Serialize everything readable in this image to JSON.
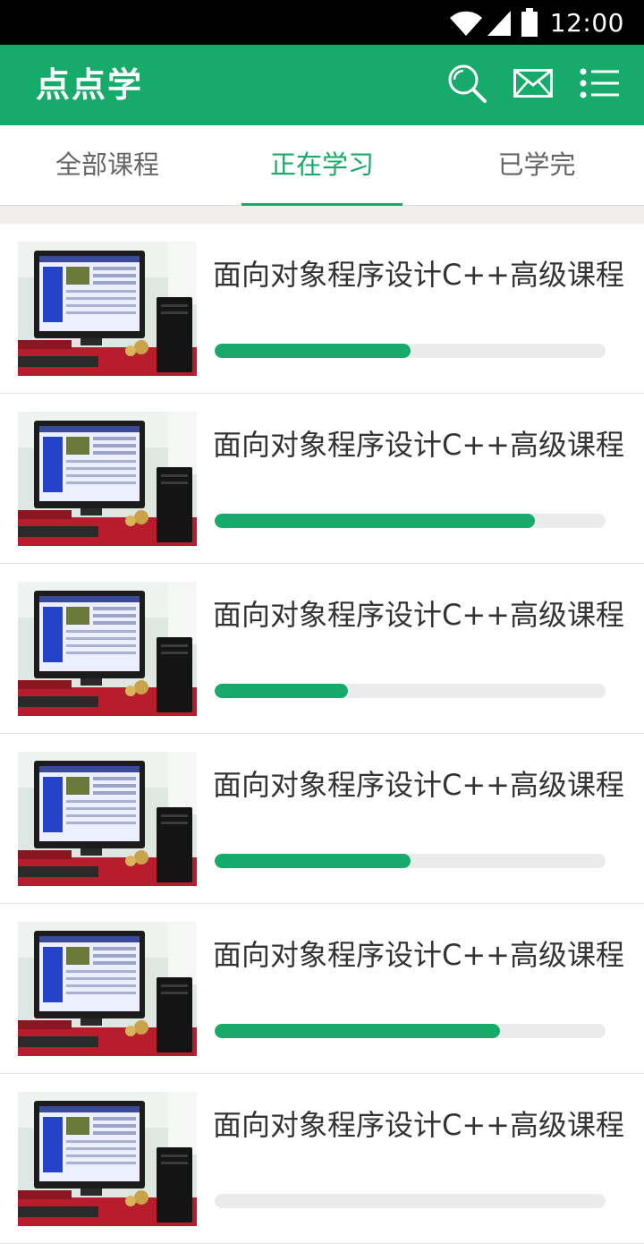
{
  "status_bar": {
    "time": "12:00",
    "icons": [
      "wifi-icon",
      "signal-icon",
      "battery-icon"
    ]
  },
  "app_bar": {
    "title": "点点学",
    "actions": [
      "search-icon",
      "mail-icon",
      "menu-list-icon"
    ]
  },
  "tabs": [
    {
      "label": "全部课程",
      "active": false
    },
    {
      "label": "正在学习",
      "active": true
    },
    {
      "label": "已学完",
      "active": false
    }
  ],
  "courses": [
    {
      "title": "面向对象程序设计C++高级课程",
      "progress": 0.5
    },
    {
      "title": "面向对象程序设计C++高级课程",
      "progress": 0.82
    },
    {
      "title": "面向对象程序设计C++高级课程",
      "progress": 0.34
    },
    {
      "title": "面向对象程序设计C++高级课程",
      "progress": 0.5
    },
    {
      "title": "面向对象程序设计C++高级课程",
      "progress": 0.73
    },
    {
      "title": "面向对象程序设计C++高级课程",
      "progress": 0.0
    }
  ],
  "colors": {
    "brand": "#17ab6b",
    "track": "#ebebeb",
    "status_bar": "#000000"
  }
}
